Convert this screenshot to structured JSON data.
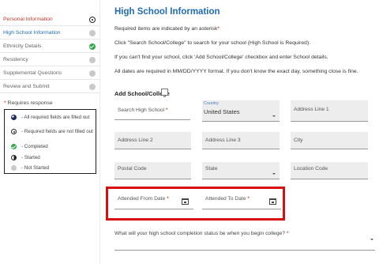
{
  "sidebar": {
    "items": [
      {
        "label": "Personal Information",
        "status": "unfilled",
        "color": "#c0392b"
      },
      {
        "label": "High School Information",
        "status": "notstarted",
        "color": "#1f6cb3"
      },
      {
        "label": "Ethnicity Details",
        "status": "complete",
        "color": "#666666"
      },
      {
        "label": "Residency",
        "status": "notstarted",
        "color": "#666666"
      },
      {
        "label": "Supplemental Questions",
        "status": "notstarted",
        "color": "#666666"
      },
      {
        "label": "Review and Submit",
        "status": "notstarted",
        "color": "#666666"
      }
    ],
    "requires_label": "Requires response",
    "requires_marker": "*",
    "legend": [
      {
        "icon": "allreq",
        "text": "- All required fields are filled out"
      },
      {
        "icon": "unfilled",
        "text": "- Required fields are not filled out"
      },
      {
        "icon": "complete",
        "text": "- Completed"
      },
      {
        "icon": "started",
        "text": "- Started"
      },
      {
        "icon": "notstarted",
        "text": "- Not Started"
      }
    ]
  },
  "main": {
    "title": "High School Information",
    "required_note": "Required items are indicated by an asterisk",
    "required_note_mark": "*",
    "search_note": "Click \"Search School/College\" to search for your school (High School is Required).",
    "cant_find_note": "If you can't find your school, click 'Add School/College' checkbox and enter School details.",
    "dates_note": "All dates are required in MM/DD/YYYY format. If you don't know the exact day, something close is fine.",
    "add_school_label": "Add School/College",
    "fields": {
      "search_high_school": "Search High School",
      "country_small": "Country",
      "country_value": "United States",
      "address1": "Address Line 1",
      "address2": "Address Line 2",
      "address3": "Address Line 3",
      "city": "City",
      "postal": "Postal Code",
      "state": "State",
      "location_code": "Location Code",
      "attended_from": "Attended From Date",
      "attended_to": "Attended To Date",
      "required_mark": "*"
    },
    "status_question": "What will your high school completion status be when you begin college?",
    "status_question_mark": "*"
  },
  "colors": {
    "accent": "#1f6cb3",
    "highlight": "#d90f0f",
    "complete": "#2eaa47",
    "required": "#cc0000"
  }
}
